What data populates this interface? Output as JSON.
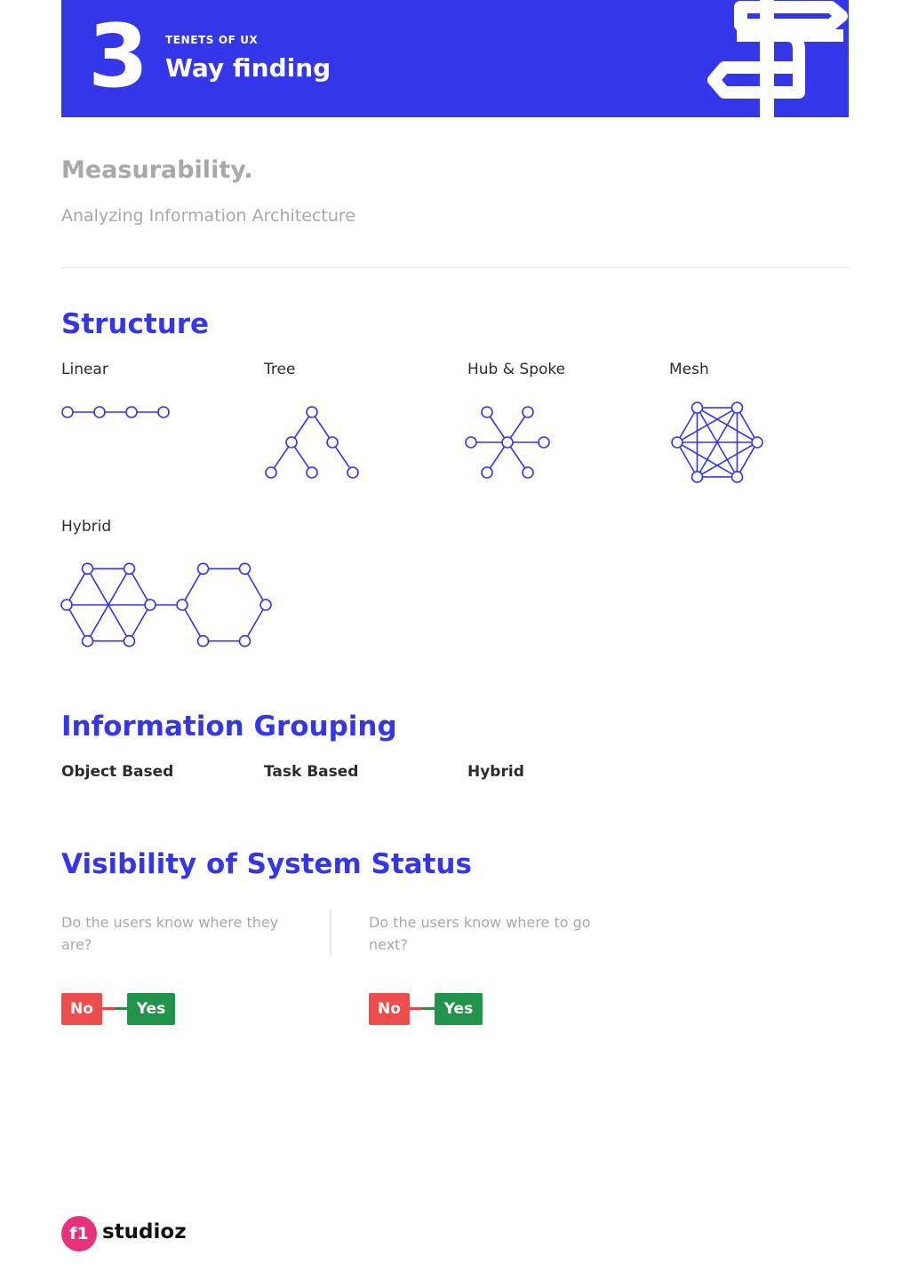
{
  "header": {
    "number": "3",
    "kicker": "TENETS OF UX",
    "title": "Way finding",
    "icon": "signpost-icon",
    "color": "#3436ea"
  },
  "intro": {
    "heading": "Measurability.",
    "subheading": "Analyzing Information Architecture"
  },
  "structure": {
    "title": "Structure",
    "items": [
      {
        "label": "Linear",
        "icon": "linear-diagram"
      },
      {
        "label": "Tree",
        "icon": "tree-diagram"
      },
      {
        "label": "Hub & Spoke",
        "icon": "hub-and-spoke-diagram"
      },
      {
        "label": "Mesh",
        "icon": "mesh-diagram"
      },
      {
        "label": "Hybrid",
        "icon": "hybrid-diagram"
      }
    ]
  },
  "grouping": {
    "title": "Information Grouping",
    "items": [
      "Object Based",
      "Task Based",
      "Hybrid"
    ]
  },
  "visibility": {
    "title": "Visibility of System Status",
    "questions": [
      {
        "text": "Do the users know where they are?",
        "no": "No",
        "yes": "Yes"
      },
      {
        "text": "Do the users know where to go next?",
        "no": "No",
        "yes": "Yes"
      }
    ],
    "no_color": "#ee4d4d",
    "yes_color": "#21934b"
  },
  "footer": {
    "logo_mark": "f1",
    "logo_text": "studioz",
    "logo_color": "#e9307b"
  }
}
